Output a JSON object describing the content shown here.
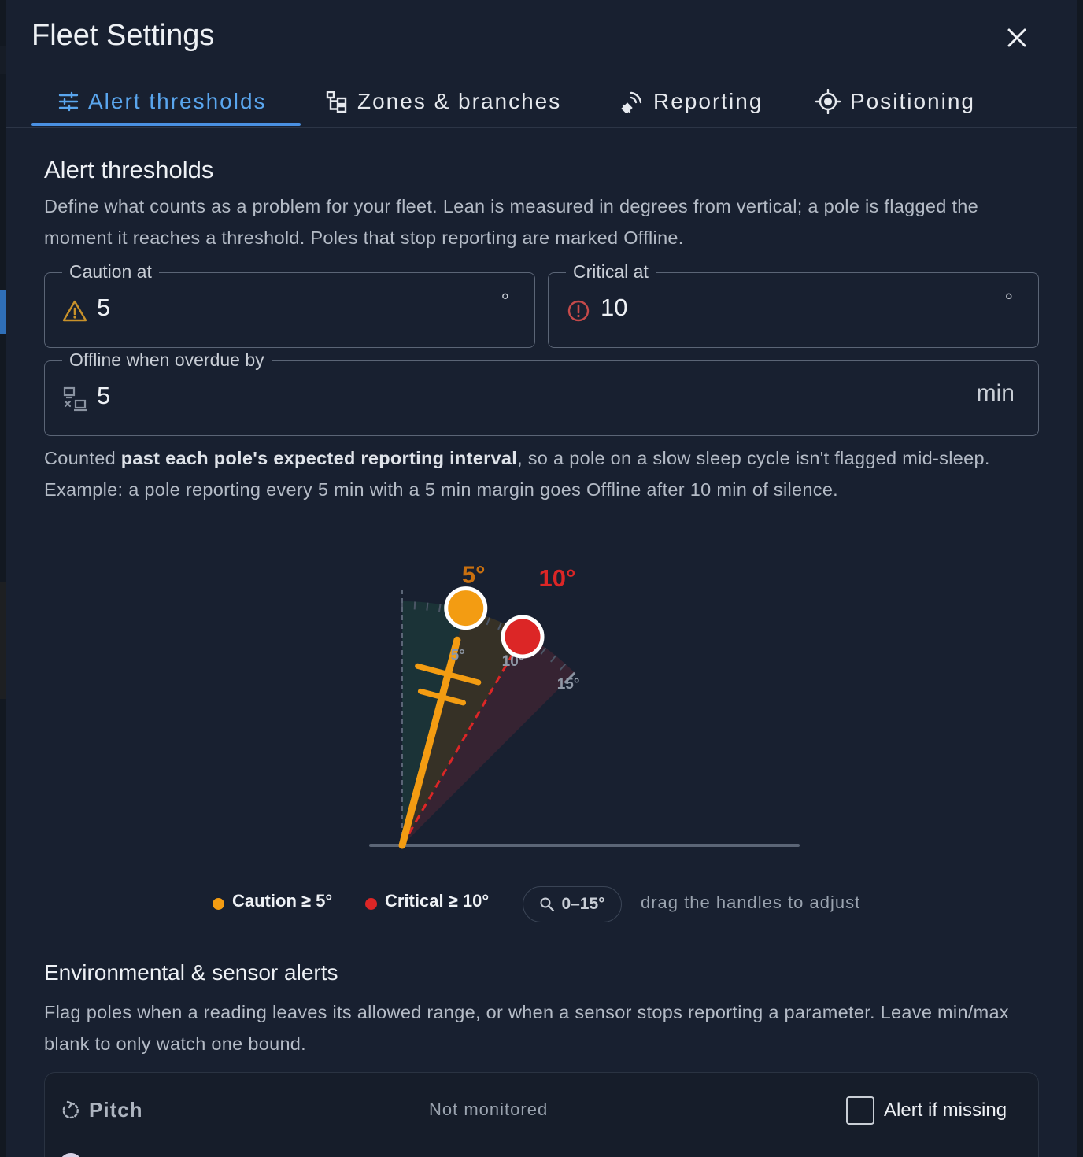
{
  "dialog": {
    "title": "Fleet Settings",
    "close_icon": "close-icon"
  },
  "tabs": [
    {
      "label": "Alert thresholds",
      "icon": "tune-icon",
      "active": true
    },
    {
      "label": "Zones & branches",
      "icon": "hierarchy-icon",
      "active": false
    },
    {
      "label": "Reporting",
      "icon": "satellite-signal-icon",
      "active": false
    },
    {
      "label": "Positioning",
      "icon": "gps-target-icon",
      "active": false
    }
  ],
  "alert_thresholds": {
    "title": "Alert thresholds",
    "description": "Define what counts as a problem for your fleet. Lean is measured in degrees from vertical; a pole is flagged the moment it reaches a threshold. Poles that stop reporting are marked Offline.",
    "caution": {
      "label": "Caution at",
      "value": "5",
      "unit": "°",
      "icon": "warning-triangle-icon"
    },
    "critical": {
      "label": "Critical at",
      "value": "10",
      "unit": "°",
      "icon": "error-circle-icon"
    },
    "offline": {
      "label": "Offline when overdue by",
      "value": "5",
      "unit": "min",
      "icon": "offline-devices-icon"
    },
    "offline_note_prefix": "Counted ",
    "offline_note_bold": "past each pole's expected reporting interval",
    "offline_note_suffix": ", so a pole on a slow sleep cycle isn't flagged mid-sleep. Example: a pole reporting every 5 min with a 5 min margin goes Offline after 10 min of silence."
  },
  "lean_gauge": {
    "caution_deg": 5,
    "critical_deg": 10,
    "max_deg": 15,
    "caution_label": "5°",
    "critical_label": "10°",
    "tick_labels": [
      "5°",
      "10°",
      "15°"
    ],
    "colors": {
      "caution": "#f39c12",
      "critical": "#dc2626"
    }
  },
  "legend": {
    "caution": "Caution ≥ 5°",
    "critical": "Critical ≥ 10°",
    "zoom_chip": "0–15°",
    "hint": "drag the handles to adjust"
  },
  "environmental": {
    "title": "Environmental & sensor alerts",
    "description": "Flag poles when a reading leaves its allowed range, or when a sensor stops reporting a parameter. Leave min/max blank to only watch one bound.",
    "sensors": [
      {
        "name": "Pitch",
        "icon": "rotate-icon",
        "status": "Not monitored",
        "alert_if_missing_label": "Alert if missing",
        "alert_if_missing": false
      }
    ]
  }
}
